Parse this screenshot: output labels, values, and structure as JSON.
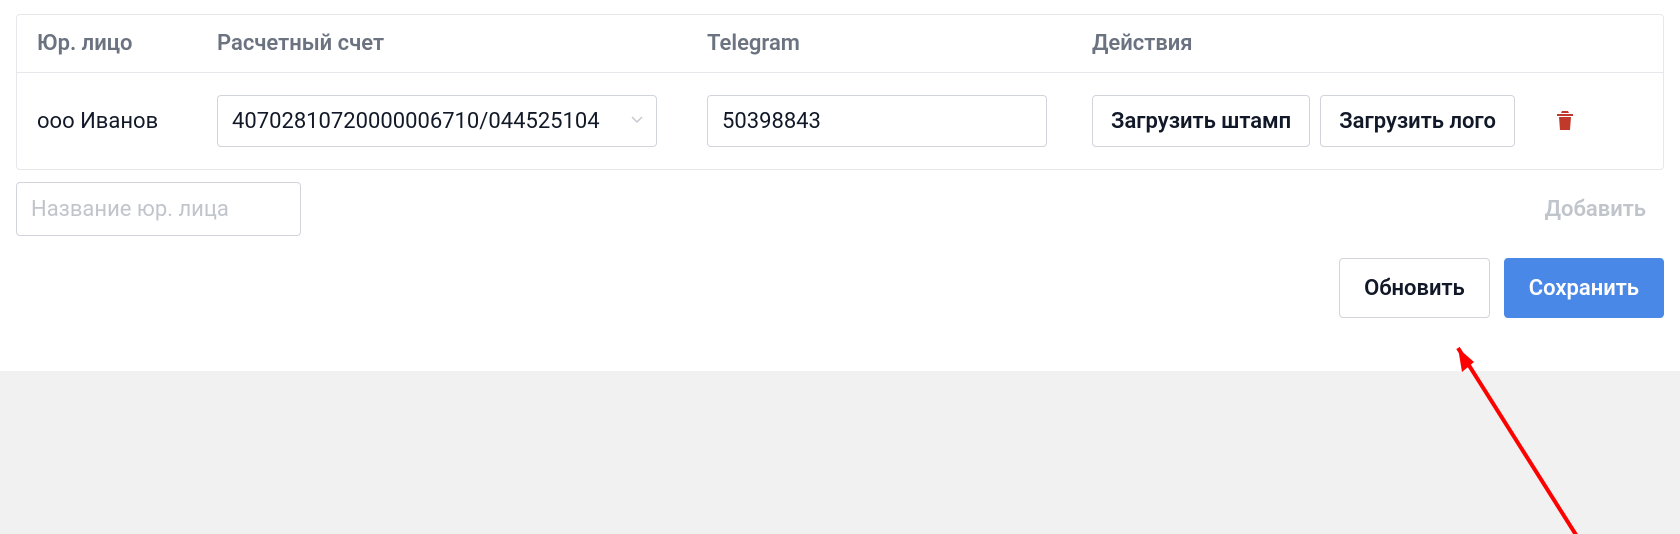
{
  "table": {
    "headers": {
      "entity": "Юр. лицо",
      "account": "Расчетный счет",
      "telegram": "Telegram",
      "actions": "Действия"
    },
    "row": {
      "entity_name": "ооо Иванов",
      "account_value": "40702810720000006710/044525104",
      "telegram_value": "50398843",
      "upload_stamp_label": "Загрузить штамп",
      "upload_logo_label": "Загрузить лого"
    }
  },
  "add_form": {
    "entity_placeholder": "Название юр. лица",
    "add_label": "Добавить"
  },
  "footer": {
    "refresh_label": "Обновить",
    "save_label": "Сохранить"
  }
}
